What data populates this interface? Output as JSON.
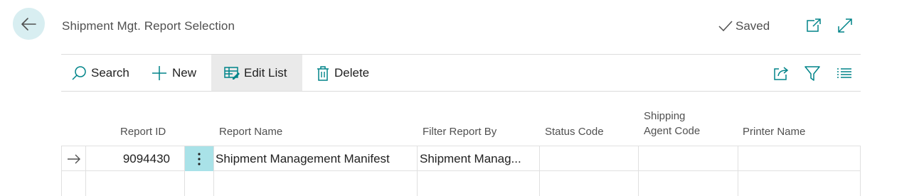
{
  "header": {
    "title": "Shipment Mgt. Report Selection",
    "saved_label": "Saved"
  },
  "actions": {
    "search": "Search",
    "new": "New",
    "edit_list": "Edit List",
    "delete": "Delete"
  },
  "columns": {
    "report_id": "Report ID",
    "report_name": "Report Name",
    "filter_report_by": "Filter Report By",
    "status_code": "Status Code",
    "shipping_agent_code_line1": "Shipping",
    "shipping_agent_code_line2": "Agent Code",
    "printer_name": "Printer Name"
  },
  "rows": [
    {
      "report_id": "9094430",
      "report_name": "Shipment Management Manifest",
      "filter_report_by": "Shipment Manag...",
      "status_code": "",
      "shipping_agent_code": "",
      "printer_name": ""
    }
  ],
  "icons": {
    "back": "arrow-left-icon",
    "saved": "checkmark-icon",
    "open_new_window": "open-in-new-window-icon",
    "expand": "expand-icon",
    "search": "search-icon",
    "new": "plus-icon",
    "edit_list": "edit-list-icon",
    "delete": "trash-icon",
    "share": "share-icon",
    "filter": "filter-icon",
    "list_view": "list-view-icon",
    "row_selector": "arrow-right-icon",
    "row_menu": "vertical-dots-icon"
  },
  "colors": {
    "accent": "#008489",
    "back_bg": "#d8eef1",
    "row_menu_bg": "#a9e2e8",
    "active_action_bg": "#eaeaea"
  }
}
